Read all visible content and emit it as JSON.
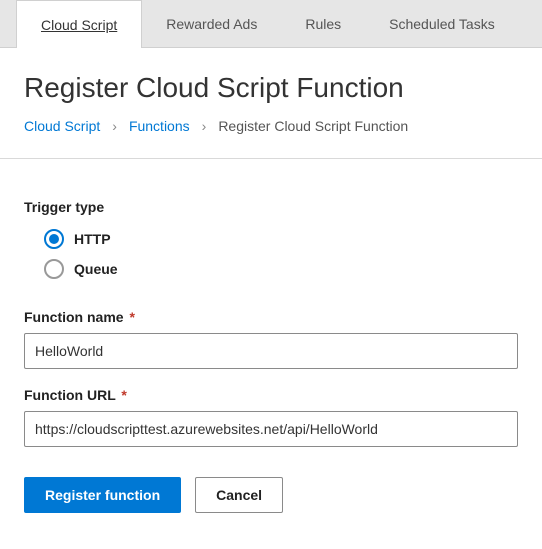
{
  "tabs": [
    {
      "label": "Cloud Script",
      "active": true
    },
    {
      "label": "Rewarded Ads",
      "active": false
    },
    {
      "label": "Rules",
      "active": false
    },
    {
      "label": "Scheduled Tasks",
      "active": false
    }
  ],
  "page": {
    "title": "Register Cloud Script Function"
  },
  "breadcrumb": {
    "items": [
      {
        "label": "Cloud Script",
        "link": true
      },
      {
        "label": "Functions",
        "link": true
      },
      {
        "label": "Register Cloud Script Function",
        "link": false
      }
    ],
    "separator": "›"
  },
  "trigger": {
    "section_label": "Trigger type",
    "options": [
      {
        "label": "HTTP",
        "selected": true
      },
      {
        "label": "Queue",
        "selected": false
      }
    ]
  },
  "fields": {
    "function_name": {
      "label": "Function name",
      "required_marker": "*",
      "value": "HelloWorld"
    },
    "function_url": {
      "label": "Function URL",
      "required_marker": "*",
      "value": "https://cloudscripttest.azurewebsites.net/api/HelloWorld"
    }
  },
  "actions": {
    "primary": "Register function",
    "secondary": "Cancel"
  }
}
